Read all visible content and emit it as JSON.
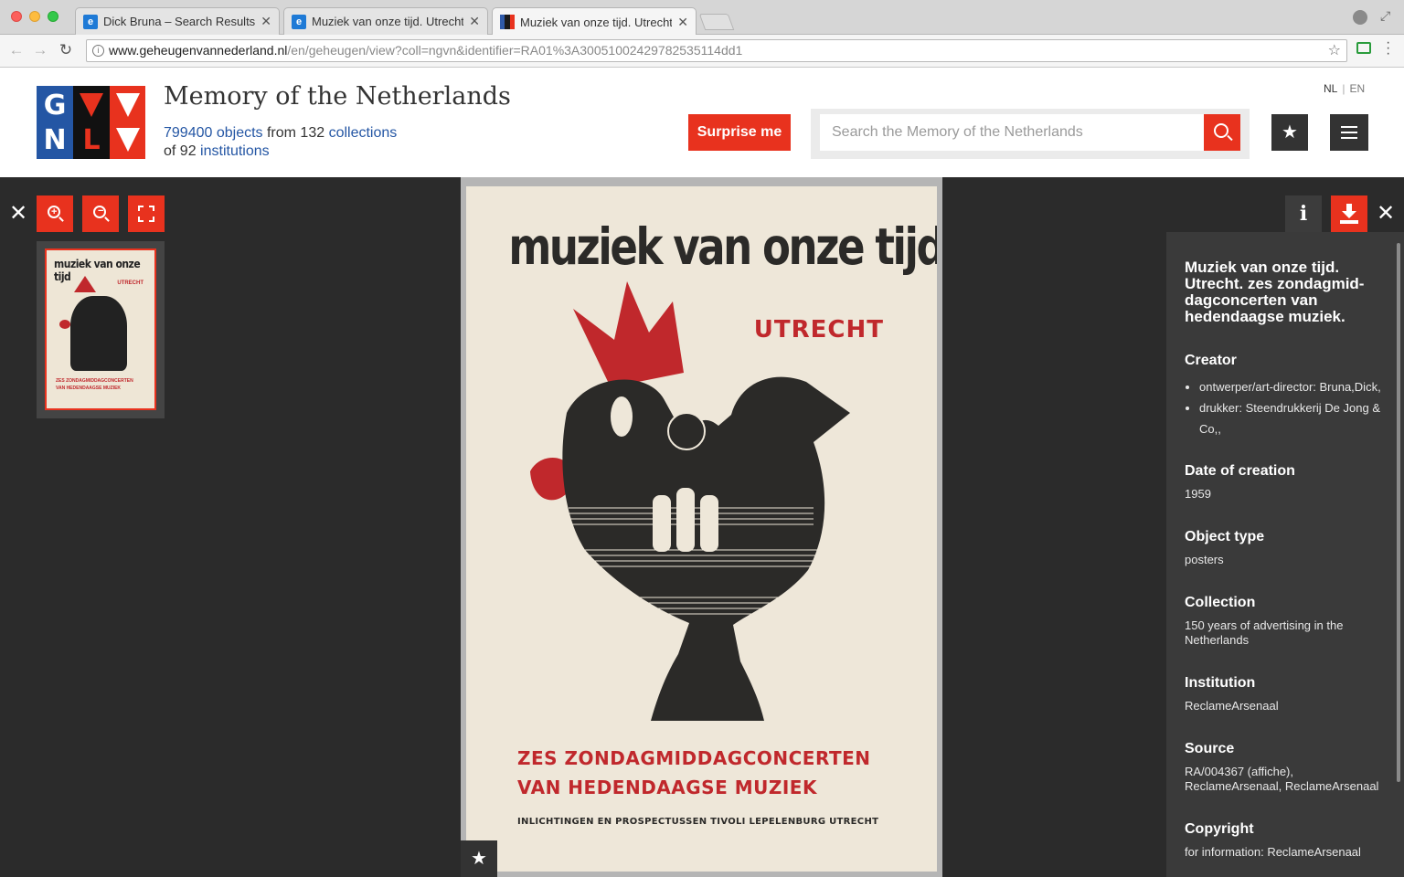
{
  "browser": {
    "tabs": [
      {
        "title": "Dick Bruna – Search Results –"
      },
      {
        "title": "Muziek van onze tijd. Utrecht"
      },
      {
        "title": "Muziek van onze tijd. Utrecht"
      }
    ],
    "url_host": "www.geheugenvannederland.nl",
    "url_path": "/en/geheugen/view?coll=ngvn&identifier=RA01%3A30051002429782535114dd1"
  },
  "site": {
    "logo_letters": [
      "G",
      "N",
      "L"
    ],
    "title": "Memory of the Netherlands",
    "stats": {
      "objects_count": "799400 objects",
      "from": "from 132",
      "collections": "collections",
      "of": "of 92",
      "institutions": "institutions"
    },
    "lang": {
      "nl": "NL",
      "en": "EN"
    },
    "surprise_label": "Surprise me",
    "search_placeholder": "Search the Memory of the Netherlands"
  },
  "poster": {
    "title": "muziek van onze tijd",
    "city": "UTRECHT",
    "line1": "ZES ZONDAGMIDDAGCONCERTEN",
    "line2": "VAN HEDENDAAGSE MUZIEK",
    "line3": "INLICHTINGEN EN PROSPECTUSSEN TIVOLI LEPELENBURG UTRECHT"
  },
  "info": {
    "title": "Muziek van onze tijd. Utrecht. zes zondagmid-dagconcerten van hedendaagse muziek.",
    "fields": {
      "creator_label": "Creator",
      "creator_items": [
        "ontwerper/art-director: Bruna,Dick,",
        "drukker: Steendrukkerij De Jong & Co,,"
      ],
      "date_label": "Date of creation",
      "date_value": "1959",
      "type_label": "Object type",
      "type_value": "posters",
      "collection_label": "Collection",
      "collection_value": "150 years of advertising in the Netherlands",
      "institution_label": "Institution",
      "institution_value": "ReclameArsenaal",
      "source_label": "Source",
      "source_value": "RA/004367 (affiche), ReclameArsenaal, ReclameArsenaal",
      "copyright_label": "Copyright",
      "copyright_value": "for information: ReclameArsenaal"
    }
  },
  "colors": {
    "accent": "#e8321e",
    "brand_blue": "#2456a4",
    "dark": "#2b2b2b",
    "panel": "#3a3a3a",
    "poster_red": "#c0282c"
  },
  "icons": {
    "zoom_in": "zoom-in-icon",
    "zoom_out": "zoom-out-icon",
    "fullscreen": "fullscreen-icon",
    "close": "close-icon",
    "info": "info-icon",
    "download": "download-icon",
    "favorite": "star-icon",
    "menu": "hamburger-icon",
    "search": "search-icon"
  }
}
